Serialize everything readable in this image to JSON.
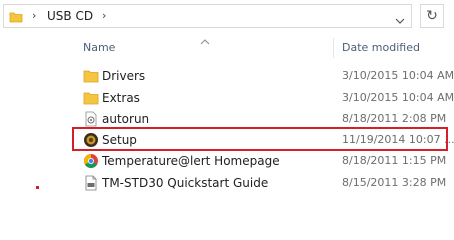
{
  "address": {
    "path": [
      "USB CD"
    ],
    "folder_icon": "folder-icon",
    "separator_icon": "chevron-right-icon",
    "dropdown_icon": "chevron-down-icon",
    "refresh_icon": "refresh-icon"
  },
  "columns": {
    "name": "Name",
    "date": "Date modified",
    "sort_icon": "sort-up-icon"
  },
  "files": [
    {
      "name": "Drivers",
      "date": "3/10/2015 10:04 AM",
      "icon": "folder-icon"
    },
    {
      "name": "Extras",
      "date": "3/10/2015 10:04 AM",
      "icon": "folder-icon"
    },
    {
      "name": "autorun",
      "date": "8/18/2011 2:08 PM",
      "icon": "autorun-file-icon"
    },
    {
      "name": "Setup",
      "date": "11/19/2014 10:07 ...",
      "icon": "setup-app-icon",
      "highlighted": true
    },
    {
      "name": "Temperature@lert Homepage",
      "date": "8/18/2011 1:15 PM",
      "icon": "chrome-icon"
    },
    {
      "name": "TM-STD30 Quickstart Guide",
      "date": "8/15/2011 3:28 PM",
      "icon": "pdf-file-icon"
    }
  ],
  "colors": {
    "highlight_border": "#d51f28",
    "header_text": "#4c607a",
    "folder_yellow": "#f5c542"
  }
}
